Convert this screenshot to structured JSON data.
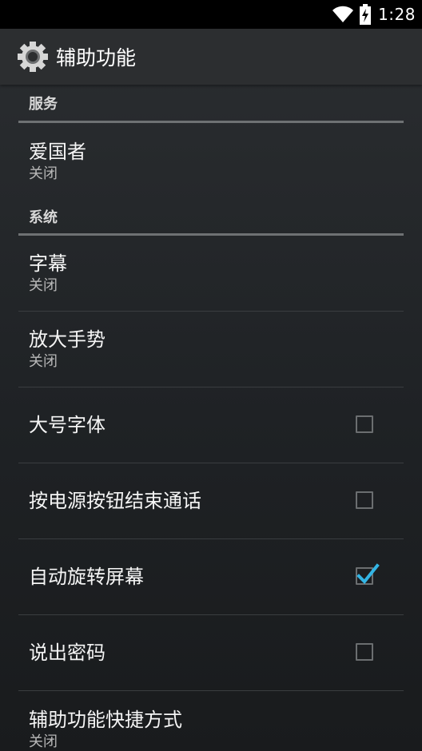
{
  "status_bar": {
    "time": "1:28",
    "wifi_icon": "wifi-icon",
    "battery_icon": "battery-charging-icon"
  },
  "action_bar": {
    "title": "辅助功能",
    "icon": "gear-icon"
  },
  "sections": {
    "services": {
      "header": "服务",
      "items": [
        {
          "title": "爱国者",
          "summary": "关闭"
        }
      ]
    },
    "system": {
      "header": "系统",
      "items": [
        {
          "title": "字幕",
          "summary": "关闭"
        },
        {
          "title": "放大手势",
          "summary": "关闭"
        },
        {
          "title": "大号字体",
          "checked": false
        },
        {
          "title": "按电源按钮结束通话",
          "checked": false
        },
        {
          "title": "自动旋转屏幕",
          "checked": true
        },
        {
          "title": "说出密码",
          "checked": false
        },
        {
          "title": "辅助功能快捷方式",
          "summary": "关闭"
        }
      ]
    }
  },
  "colors": {
    "accent": "#33b5e5",
    "divider": "#6e7173"
  }
}
